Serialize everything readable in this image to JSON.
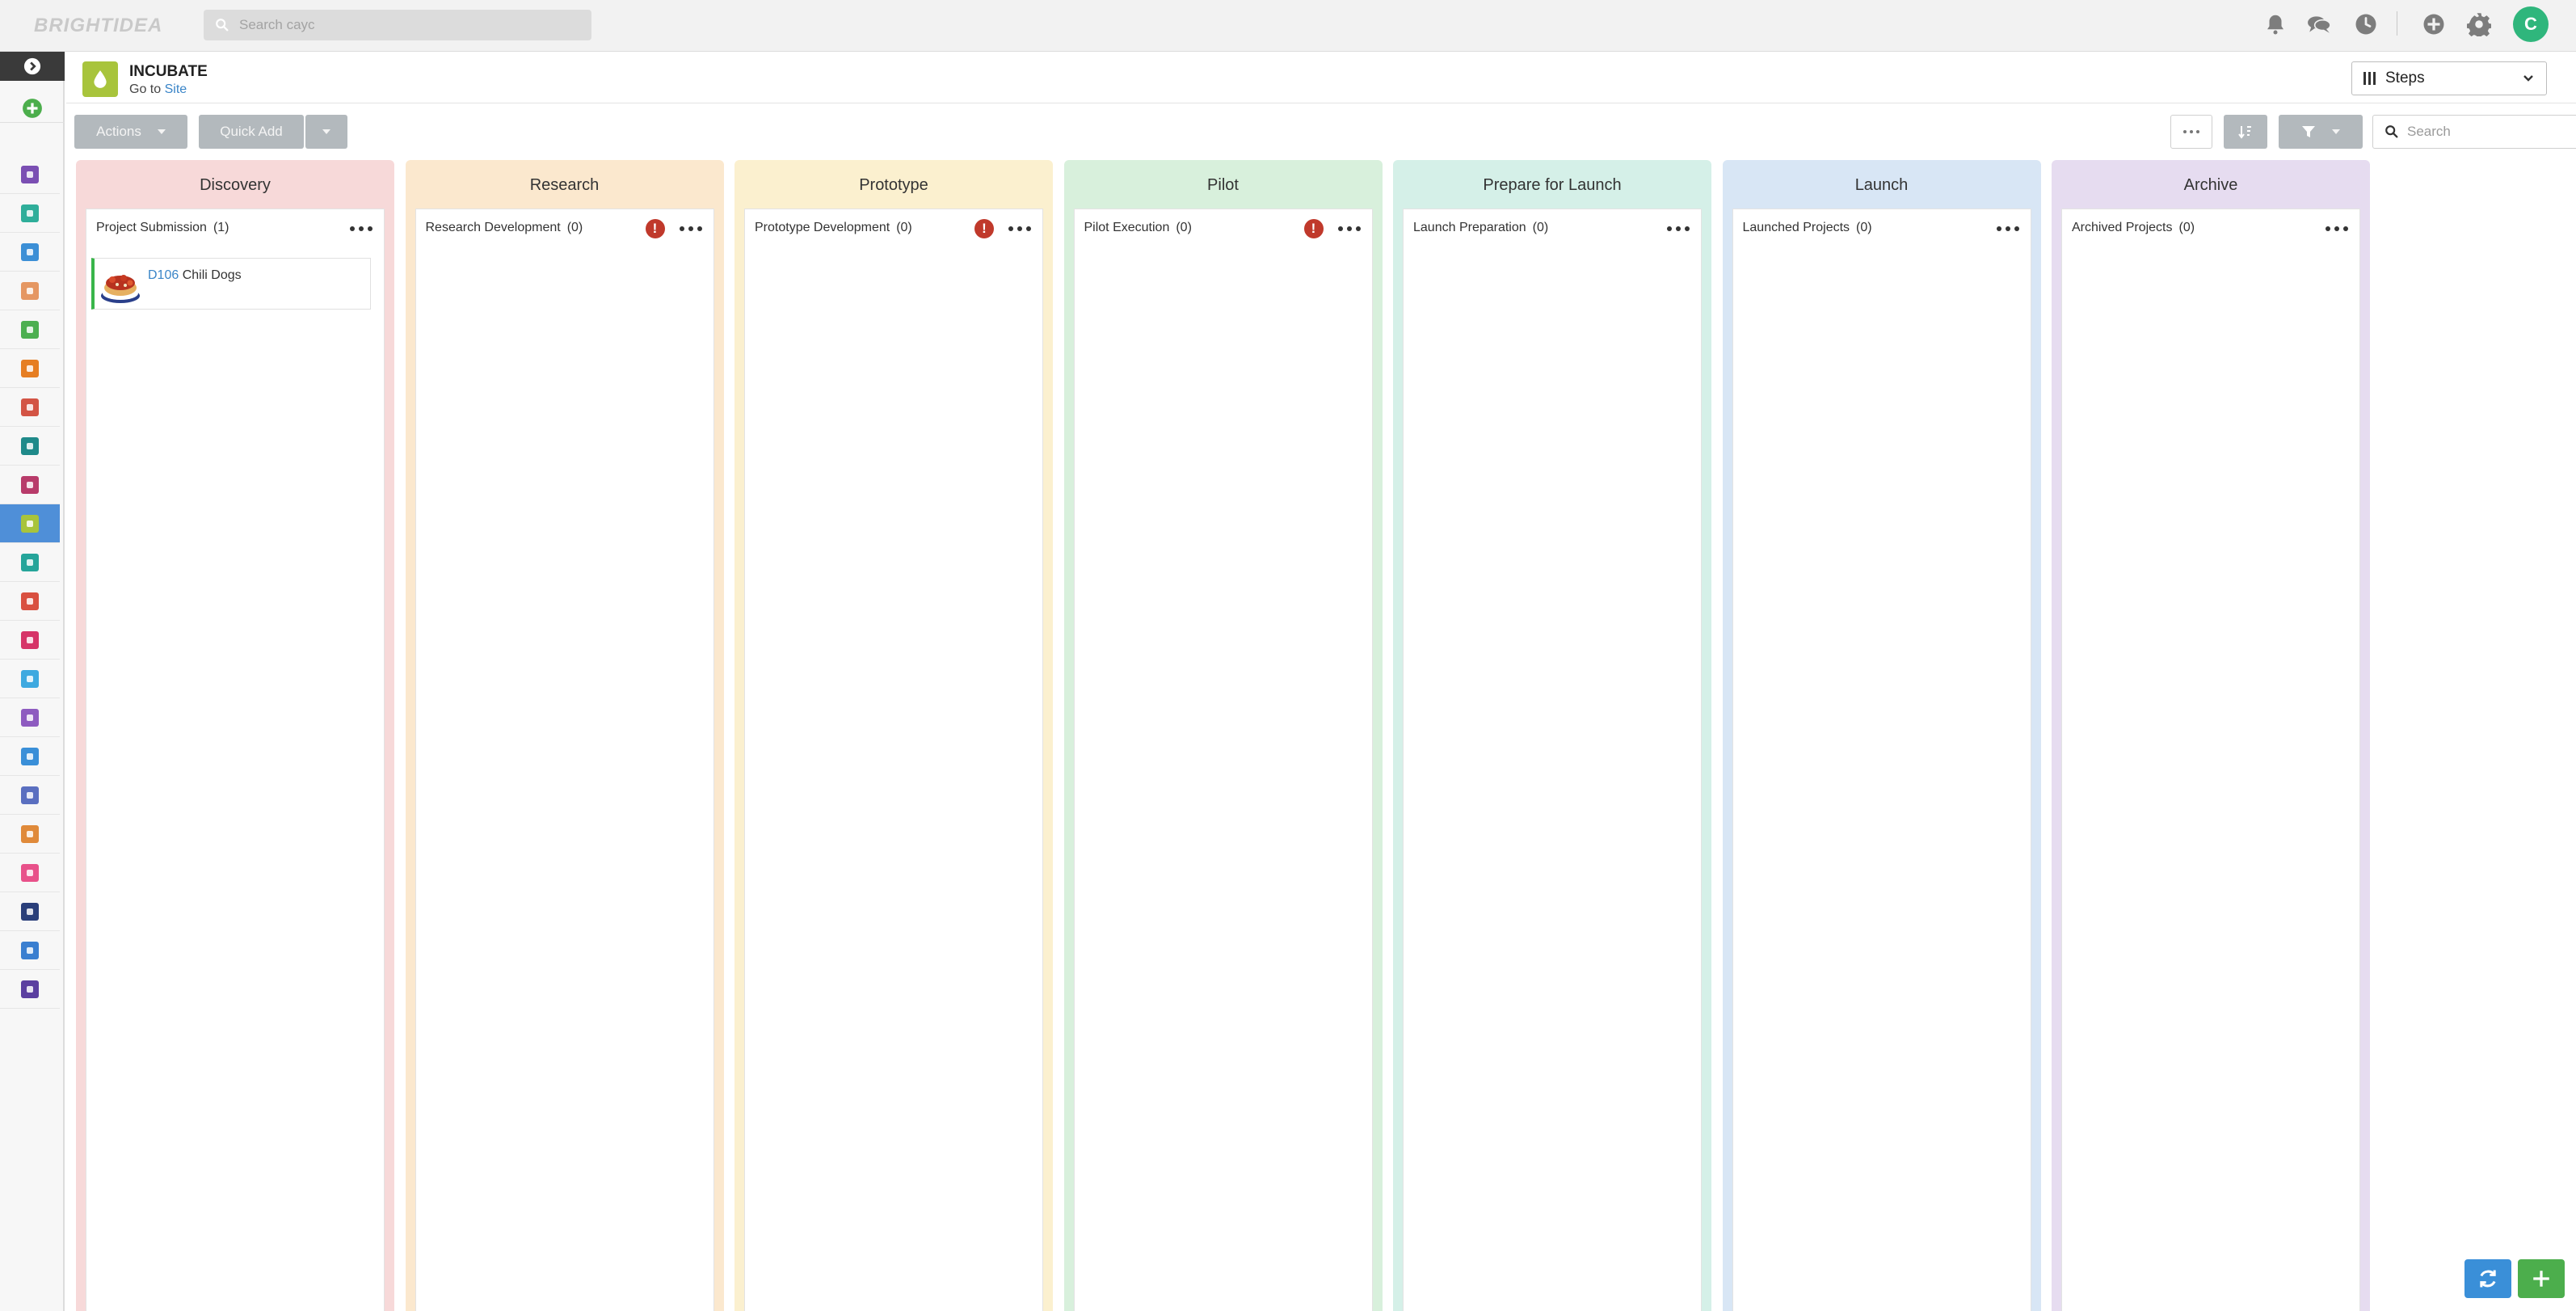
{
  "header": {
    "logo_text": "BRIGHTIDEA",
    "search_placeholder": "Search cayc",
    "avatar_initial": "C",
    "icons": [
      "bell-icon",
      "chat-icon",
      "clock-icon",
      "plus-circle-icon",
      "gear-icon"
    ]
  },
  "sidebar": {
    "toggle_icon": "chevron-right-icon",
    "add_icon": "plus-circle-icon",
    "items": [
      {
        "color": "#7b4fb3"
      },
      {
        "color": "#2fae9a"
      },
      {
        "color": "#3c8fd6"
      },
      {
        "color": "#e59762"
      },
      {
        "color": "#4caf50"
      },
      {
        "color": "#e67e22"
      },
      {
        "color": "#d35445"
      },
      {
        "color": "#1f8a8a"
      },
      {
        "color": "#b83b6a"
      },
      {
        "color": "#a8c43c",
        "active": true
      },
      {
        "color": "#25a59a"
      },
      {
        "color": "#d95040"
      },
      {
        "color": "#d63468"
      },
      {
        "color": "#3ea9e0"
      },
      {
        "color": "#8e5bc0"
      },
      {
        "color": "#3a8fd8"
      },
      {
        "color": "#5a6fc0"
      },
      {
        "color": "#e08a3a"
      },
      {
        "color": "#e8518a"
      },
      {
        "color": "#2a3f7a"
      },
      {
        "color": "#3a7fd0"
      },
      {
        "color": "#5b3fa0"
      }
    ]
  },
  "app": {
    "title": "INCUBATE",
    "goto_label": "Go to",
    "site_link": "Site",
    "view_label": "Steps"
  },
  "toolbar": {
    "actions_label": "Actions",
    "quick_add_label": "Quick Add",
    "search_placeholder": "Search"
  },
  "columns": [
    {
      "title": "Discovery",
      "bg": "#f7d9d9",
      "lane": "Project Submission",
      "count": "(1)",
      "warn": false,
      "cards": [
        {
          "id": "D106",
          "name": "Chili Dogs"
        }
      ]
    },
    {
      "title": "Research",
      "bg": "#fbe8ce",
      "lane": "Research Development",
      "count": "(0)",
      "warn": true,
      "cards": []
    },
    {
      "title": "Prototype",
      "bg": "#fbf0cf",
      "lane": "Prototype Development",
      "count": "(0)",
      "warn": true,
      "cards": []
    },
    {
      "title": "Pilot",
      "bg": "#d8f0dc",
      "lane": "Pilot Execution",
      "count": "(0)",
      "warn": true,
      "cards": []
    },
    {
      "title": "Prepare for Launch",
      "bg": "#d5f0e8",
      "lane": "Launch Preparation",
      "count": "(0)",
      "warn": false,
      "cards": []
    },
    {
      "title": "Launch",
      "bg": "#d8e6f5",
      "lane": "Launched Projects",
      "count": "(0)",
      "warn": false,
      "cards": []
    },
    {
      "title": "Archive",
      "bg": "#e6dcf0",
      "lane": "Archived Projects",
      "count": "(0)",
      "warn": false,
      "cards": []
    }
  ],
  "fab": {
    "refresh_color": "#3a8fd8",
    "add_color": "#4cae4c"
  }
}
